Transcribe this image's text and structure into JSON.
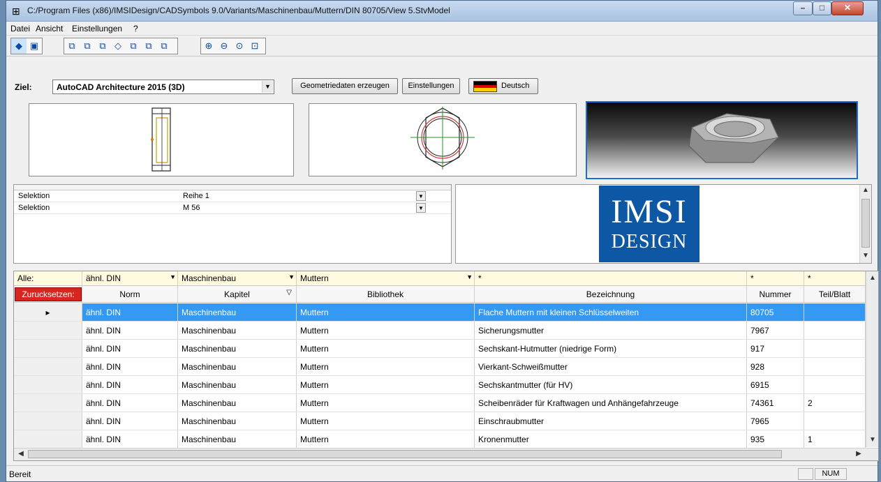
{
  "window": {
    "title": "C:/Program Files (x86)/IMSIDesign/CADSymbols 9.0/Variants/Maschinenbau/Muttern/DIN 80705/View 5.StvModel"
  },
  "menu": [
    {
      "label": "Datei"
    },
    {
      "label": "Ansicht"
    },
    {
      "label": "Einstellungen"
    },
    {
      "label": "?"
    }
  ],
  "toolbar": {
    "groups": [
      [
        "pointer-icon",
        "solid-view-icon"
      ],
      [
        "front-view-icon",
        "back-view-icon",
        "left-view-icon",
        "iso-view-icon",
        "right-view-icon",
        "top-view-icon",
        "bottom-view-icon"
      ],
      [
        "zoom-in-icon",
        "zoom-out-icon",
        "zoom-fit-icon",
        "zoom-window-icon"
      ]
    ]
  },
  "target": {
    "label": "Ziel:",
    "value": "AutoCAD Architecture 2015 (3D)",
    "generate_button": "Geometriedaten erzeugen",
    "settings_button": "Einstellungen",
    "language_button": "Deutsch",
    "flag_colors": [
      "#000000",
      "#dd0000",
      "#ffce00"
    ]
  },
  "properties": [
    {
      "key": "Selektion",
      "value": "Reihe 1"
    },
    {
      "key": "Selektion",
      "value": "M 56"
    }
  ],
  "logo": {
    "line1": "IMSI",
    "line2": "DESIGN",
    "color": "#0d57a5"
  },
  "grid": {
    "filter_label": "Alle:",
    "reset_label": "Zurucksetzen:",
    "filters": [
      "ähnl. DIN",
      "Maschinenbau",
      "Muttern",
      "*",
      "*",
      "*"
    ],
    "columns": [
      "Norm",
      "Kapitel",
      "Bibliothek",
      "Bezeichnung",
      "Nummer",
      "Teil/Blatt"
    ],
    "selected_row": 0,
    "rows": [
      [
        "ähnl. DIN",
        "Maschinenbau",
        "Muttern",
        "Flache Muttern mit kleinen Schlüsselweiten",
        "80705",
        ""
      ],
      [
        "ähnl. DIN",
        "Maschinenbau",
        "Muttern",
        "Sicherungsmutter",
        "7967",
        ""
      ],
      [
        "ähnl. DIN",
        "Maschinenbau",
        "Muttern",
        "Sechskant-Hutmutter (niedrige Form)",
        "917",
        ""
      ],
      [
        "ähnl. DIN",
        "Maschinenbau",
        "Muttern",
        "Vierkant-Schweißmutter",
        "928",
        ""
      ],
      [
        "ähnl. DIN",
        "Maschinenbau",
        "Muttern",
        "Sechskantmutter (für HV)",
        "6915",
        ""
      ],
      [
        "ähnl. DIN",
        "Maschinenbau",
        "Muttern",
        "Scheibenräder für Kraftwagen und Anhängefahrzeuge",
        "74361",
        "2"
      ],
      [
        "ähnl. DIN",
        "Maschinenbau",
        "Muttern",
        "Einschraubmutter",
        "7965",
        ""
      ],
      [
        "ähnl. DIN",
        "Maschinenbau",
        "Muttern",
        "Kronenmutter",
        "935",
        "1"
      ]
    ]
  },
  "status": {
    "text": "Bereit",
    "num": "NUM"
  }
}
